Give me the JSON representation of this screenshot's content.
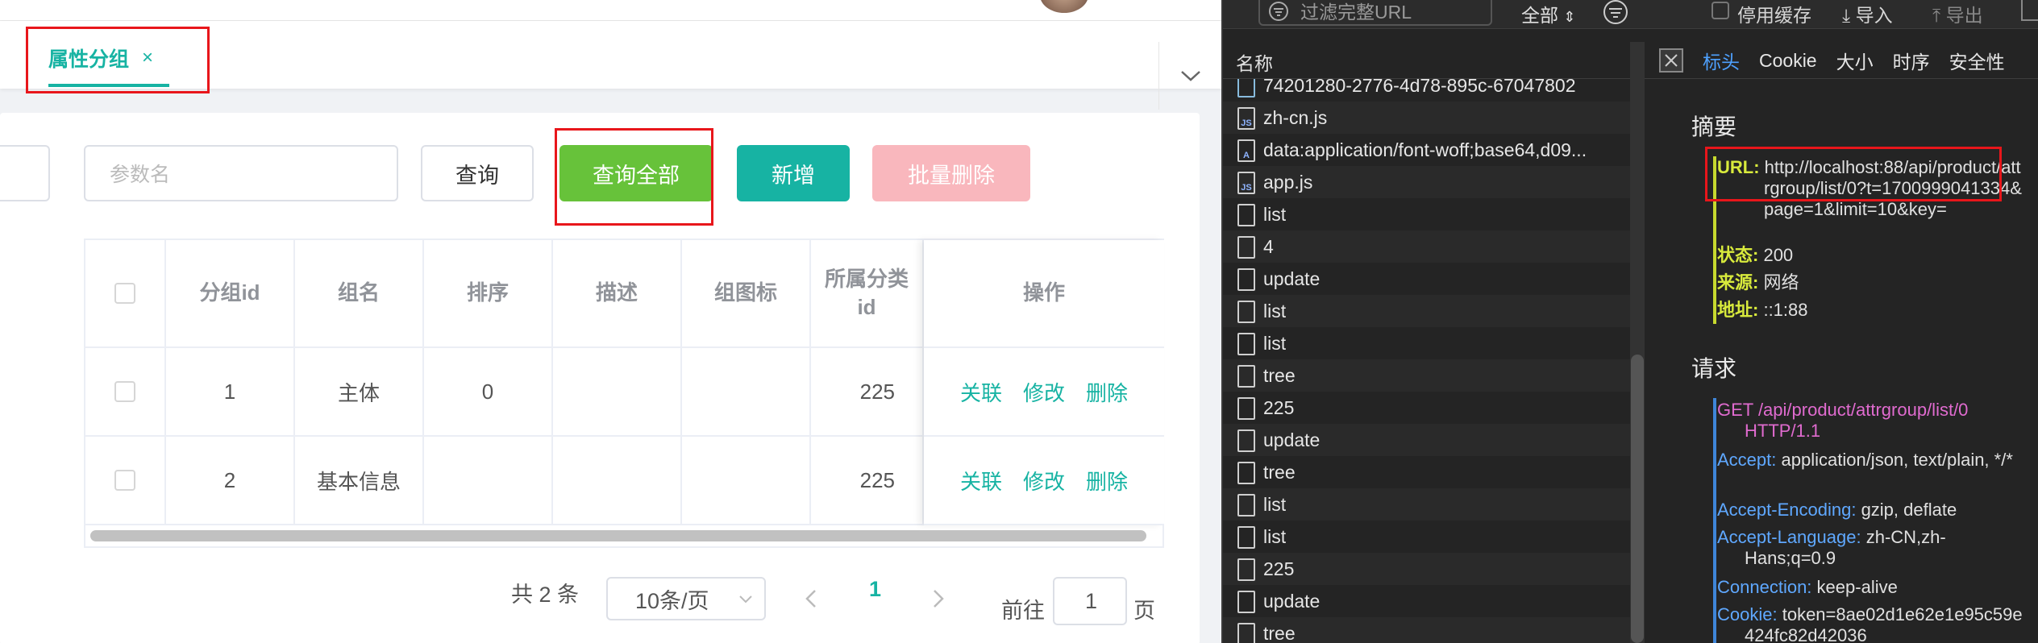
{
  "app": {
    "tab": {
      "label": "属性分组",
      "close": "×"
    },
    "toolbar": {
      "param_placeholder": "参数名",
      "query": "查询",
      "query_all": "查询全部",
      "add": "新增",
      "batch_delete": "批量删除"
    },
    "table": {
      "headers": [
        "分组id",
        "组名",
        "排序",
        "描述",
        "组图标",
        "所属分类id",
        "操作"
      ],
      "rows": [
        {
          "id": "1",
          "name": "主体",
          "sort": "0",
          "desc": "",
          "icon": "",
          "catelog_id": "225"
        },
        {
          "id": "2",
          "name": "基本信息",
          "sort": "",
          "desc": "",
          "icon": "",
          "catelog_id": "225"
        }
      ],
      "actions": [
        "关联",
        "修改",
        "删除"
      ]
    },
    "pagination": {
      "total": "共 2 条",
      "page_size": "10条/页",
      "current": "1",
      "goto_prefix": "前往",
      "goto_value": "1",
      "goto_suffix": "页"
    }
  },
  "devtools": {
    "toolbar": {
      "filter_placeholder": "过滤完整URL",
      "all": "全部",
      "disable_cache": "停用缓存",
      "import": "导入",
      "export": "导出"
    },
    "list_header": "名称",
    "tabs": [
      "标头",
      "Cookie",
      "大小",
      "时序",
      "安全性"
    ],
    "requests": [
      {
        "name": "74201280-2776-4d78-895c-67047802",
        "icon": "image"
      },
      {
        "name": "zh-cn.js",
        "icon": "js"
      },
      {
        "name": "data:application/font-woff;base64,d09...",
        "icon": "font"
      },
      {
        "name": "app.js",
        "icon": "js"
      },
      {
        "name": "list",
        "icon": "file"
      },
      {
        "name": "4",
        "icon": "file"
      },
      {
        "name": "update",
        "icon": "file"
      },
      {
        "name": "list",
        "icon": "file"
      },
      {
        "name": "list",
        "icon": "file"
      },
      {
        "name": "tree",
        "icon": "file"
      },
      {
        "name": "225",
        "icon": "file"
      },
      {
        "name": "update",
        "icon": "file"
      },
      {
        "name": "tree",
        "icon": "file"
      },
      {
        "name": "list",
        "icon": "file"
      },
      {
        "name": "list",
        "icon": "file"
      },
      {
        "name": "225",
        "icon": "file"
      },
      {
        "name": "update",
        "icon": "file"
      },
      {
        "name": "tree",
        "icon": "file"
      }
    ],
    "summary": {
      "title": "摘要",
      "url_key": "URL:",
      "url_val": "http://localhost:88/api/product/attrgroup/list/0?t=1700999041334&page=1&limit=10&key=",
      "status_key": "状态:",
      "status_val": "200",
      "source_key": "来源:",
      "source_val": "网络",
      "addr_key": "地址:",
      "addr_val": "::1:88"
    },
    "request": {
      "title": "请求",
      "line": "GET /api/product/attrgroup/list/0 HTTP/1.1",
      "headers": [
        {
          "k": "Accept:",
          "v": "application/json, text/plain, */*"
        },
        {
          "k": "Accept-Encoding:",
          "v": "gzip, deflate"
        },
        {
          "k": "Accept-Language:",
          "v": "zh-CN,zh-Hans;q=0.9"
        },
        {
          "k": "Connection:",
          "v": "keep-alive"
        },
        {
          "k": "Cookie:",
          "v": "token=8ae02d1e62e1e95c59e424fc82d42036"
        }
      ]
    }
  },
  "colors": {
    "teal": "#17b3a3",
    "green": "#67c23a",
    "pink": "#f9b7bd",
    "red_box": "#e8161b"
  }
}
